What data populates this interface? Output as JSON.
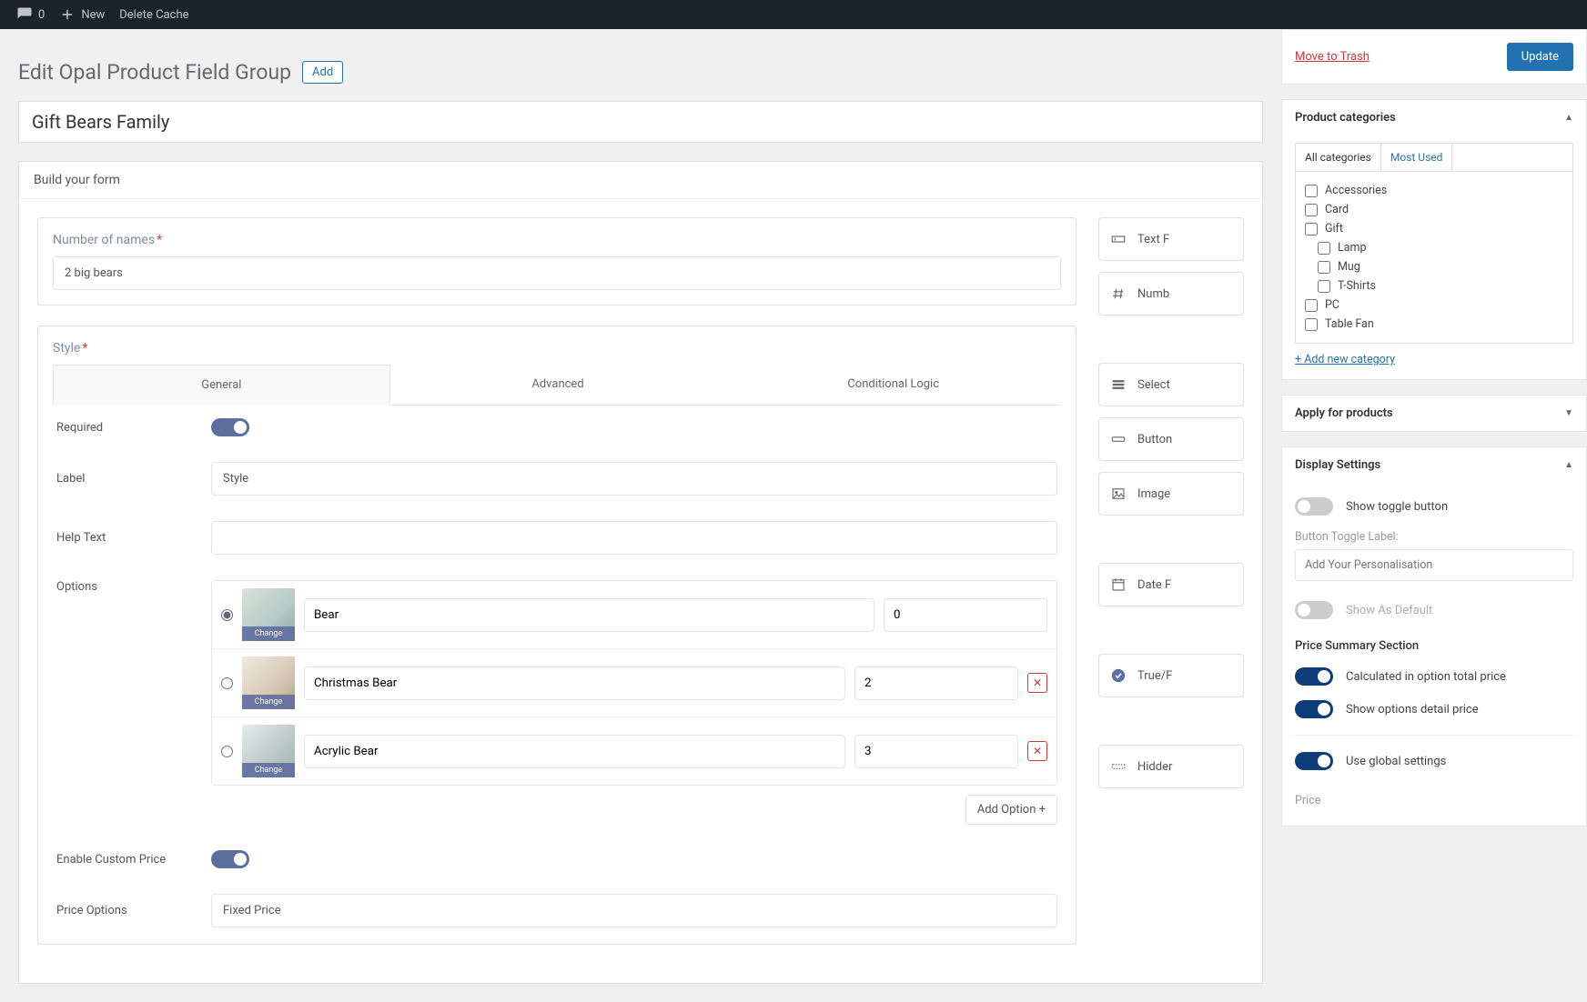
{
  "adminbar": {
    "comments_count": "0",
    "new_label": "New",
    "delete_cache": "Delete Cache"
  },
  "page": {
    "title": "Edit Opal Product Field Group",
    "add_new_label": "Add",
    "group_title": "Gift Bears Family",
    "build_label": "Build your form"
  },
  "field1": {
    "label": "Number of names",
    "value": "2 big bears"
  },
  "style": {
    "label": "Style",
    "tabs": {
      "general": "General",
      "advanced": "Advanced",
      "conditional": "Conditional Logic"
    },
    "settings": {
      "required_label": "Required",
      "label_label": "Label",
      "label_value": "Style",
      "help_label": "Help Text",
      "help_value": "",
      "options_label": "Options",
      "enable_price_label": "Enable Custom Price",
      "price_options_label": "Price Options",
      "price_options_value": "Fixed Price",
      "add_option": "Add Option +",
      "change_label": "Change",
      "options": [
        {
          "name": "Bear",
          "value": "0"
        },
        {
          "name": "Christmas Bear",
          "value": "2"
        },
        {
          "name": "Acrylic Bear",
          "value": "3"
        }
      ]
    }
  },
  "field_types": {
    "text": "Text F",
    "number": "Numb",
    "select": "Select",
    "button": "Button",
    "image": "Image",
    "date": "Date F",
    "truefalse": "True/F",
    "hidden": "Hidder"
  },
  "publish": {
    "trash": "Move to Trash",
    "update": "Update"
  },
  "categories": {
    "head": "Product categories",
    "tabs": {
      "all": "All categories",
      "most": "Most Used"
    },
    "items": [
      {
        "label": "Accessories",
        "child": false
      },
      {
        "label": "Card",
        "child": false
      },
      {
        "label": "Gift",
        "child": false
      },
      {
        "label": "Lamp",
        "child": true
      },
      {
        "label": "Mug",
        "child": true
      },
      {
        "label": "T-Shirts",
        "child": true
      },
      {
        "label": "PC",
        "child": false
      },
      {
        "label": "Table Fan",
        "child": false
      }
    ],
    "add_new": "+ Add new category"
  },
  "apply_products_head": "Apply for products",
  "display": {
    "head": "Display Settings",
    "show_toggle": "Show toggle button",
    "btn_toggle_label_caption": "Button Toggle Label:",
    "btn_toggle_placeholder": "Add Your Personalisation",
    "show_default": "Show As Default",
    "price_summary_head": "Price Summary Section",
    "calc_total": "Calculated in option total price",
    "show_detail": "Show options detail price",
    "use_global": "Use global settings",
    "price_label": "Price"
  }
}
